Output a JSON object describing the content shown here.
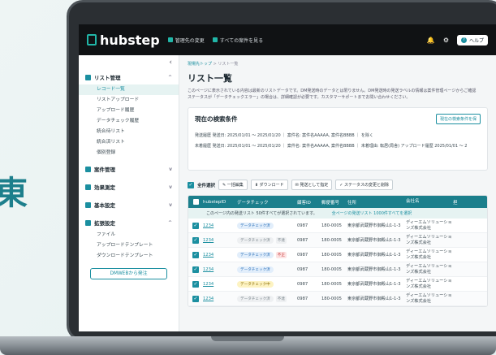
{
  "background_text": "東",
  "header": {
    "logo_text": "hubstep",
    "links": [
      "管理先の変更",
      "すべての案件を見る"
    ],
    "icons": [
      "bell-icon",
      "gear-icon"
    ],
    "help_label": "ヘルプ"
  },
  "sidebar": {
    "collapse_icon": "‹",
    "groups": [
      {
        "label": "リスト管理",
        "chevron": "^",
        "items": [
          "レコード一覧",
          "リストアップロード",
          "アップロード履歴",
          "データチェック履歴",
          "統合待リスト",
          "統合済リスト",
          "個別登録"
        ]
      },
      {
        "label": "案件管理",
        "chevron": "v",
        "items": []
      },
      {
        "label": "効果測定",
        "chevron": "v",
        "items": []
      },
      {
        "label": "基本設定",
        "chevron": "v",
        "items": []
      },
      {
        "label": "拡張設定",
        "chevron": "^",
        "items": [
          "ファイル",
          "アップロードテンプレート",
          "ダウンロードテンプレート"
        ]
      }
    ],
    "cta_label": "DMWEBから発注"
  },
  "main": {
    "breadcrumb": [
      "現場先トップ",
      "リスト一覧"
    ],
    "title": "リスト一覧",
    "description": [
      "このページに表示されている内容は最新のリストデータです。DM発送時のデータとは限りません。DM発送時の発送ラベルの情報は案件管理ページからご確認",
      "ステータスが「データチェックエラー」の場合は、詳細確認が必要です。カスタマーサポートまでお問い合わせください。"
    ],
    "conditions": {
      "title": "現在の検索条件",
      "button": "現在の検索条件を保",
      "lines": [
        "発送履歴  発送日: 2025/01/01 ～ 2025/01/20  ｜ 案件名: 案件名AAAAA, 案件名BBBB  ｜ を除く",
        "未着履歴  発送日: 2025/01/01 ～ 2025/01/20  ｜ 案件名: 案件名AAAAA, 案件名BBBB  ｜ 未着理由: 転居(局舎)   アップロード履歴  2025/01/01 ～ 2"
      ]
    },
    "toolbar": {
      "select_all": "全件選択",
      "buttons": [
        "一括編集",
        "ダウンロード",
        "発送として指定",
        "ステータスの変更と削除"
      ]
    },
    "table": {
      "headers": [
        "hubstepID",
        "データチェック",
        "顧客ID",
        "郵便番号",
        "住所",
        "会社名",
        "担"
      ],
      "selection_text": "このページ内の発送リスト 50件すべてが選択されています。",
      "selection_link": "全ページの発送リスト 1000件すべてを選択",
      "rows": [
        {
          "id": "1234",
          "status": "データチェック済",
          "pill": "blue",
          "tag": "",
          "tag_type": "",
          "cust": "0987",
          "zip": "180-0005",
          "addr": "東京都武蔵野市御殿山1-1-3",
          "company": "ディーエムソリューションズ株式会社"
        },
        {
          "id": "1234",
          "status": "データチェック済",
          "pill": "gray",
          "tag": "不達",
          "tag_type": "gray",
          "cust": "0987",
          "zip": "180-0005",
          "addr": "東京都武蔵野市御殿山1-1-3",
          "company": "ディーエムソリューションズ株式会社"
        },
        {
          "id": "1234",
          "status": "データチェック済",
          "pill": "blue",
          "tag": "不正",
          "tag_type": "red",
          "cust": "0987",
          "zip": "180-0005",
          "addr": "東京都武蔵野市御殿山1-1-3",
          "company": "ディーエムソリューションズ株式会社"
        },
        {
          "id": "1234",
          "status": "データチェック済",
          "pill": "blue",
          "tag": "",
          "tag_type": "",
          "cust": "0987",
          "zip": "180-0005",
          "addr": "東京都武蔵野市御殿山1-1-3",
          "company": "ディーエムソリューションズ株式会社"
        },
        {
          "id": "1234",
          "status": "データチェック中",
          "pill": "yellow",
          "tag": "",
          "tag_type": "",
          "cust": "0987",
          "zip": "180-0005",
          "addr": "東京都武蔵野市御殿山1-1-3",
          "company": "ディーエムソリューションズ株式会社"
        },
        {
          "id": "1234",
          "status": "データチェック済",
          "pill": "gray",
          "tag": "不達",
          "tag_type": "gray",
          "cust": "0987",
          "zip": "180-0005",
          "addr": "東京都武蔵野市御殿山1-1-3",
          "company": "ディーエムソリューションズ株式会社"
        }
      ]
    }
  },
  "colors": {
    "accent": "#1b8fa0",
    "header": "#101214",
    "table_head": "#1b7f8c"
  }
}
